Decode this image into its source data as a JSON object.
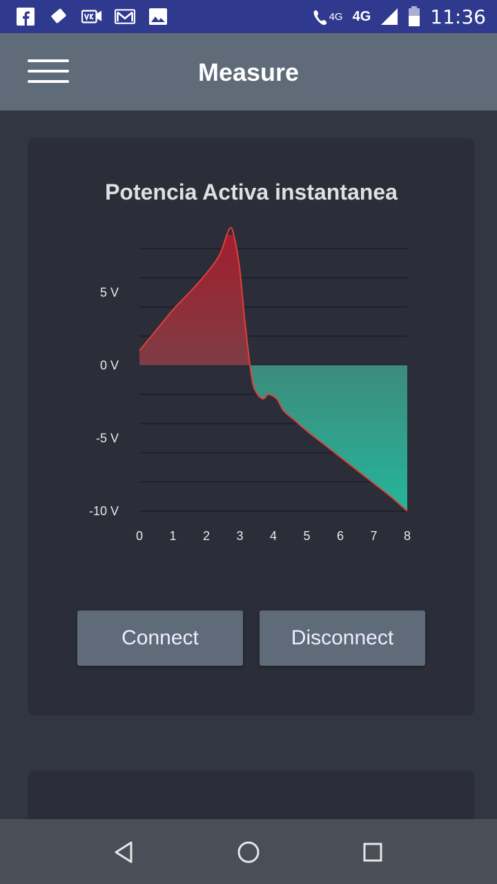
{
  "status_bar": {
    "left_icons": [
      "facebook-icon",
      "tag-icon",
      "vk-icon",
      "gmail-icon",
      "gallery-icon"
    ],
    "volte_label": "4G",
    "network_label": "4G",
    "time": "11:36"
  },
  "app_bar": {
    "title": "Measure"
  },
  "chart_card": {
    "title": "Potencia Activa instantanea",
    "connect_label": "Connect",
    "disconnect_label": "Disconnect"
  },
  "chart_data": {
    "type": "area",
    "title": "Potencia Activa instantanea",
    "x_ticks": [
      "0",
      "1",
      "2",
      "3",
      "4",
      "5",
      "6",
      "7",
      "8"
    ],
    "y_ticks": [
      "5 V",
      "0 V",
      "-5 V",
      "-10 V"
    ],
    "xlim": [
      0,
      8
    ],
    "ylim": [
      -10,
      8
    ],
    "grid": "horizontal",
    "colors": {
      "line": "#e0413b",
      "positive": "#a31d2c",
      "negative": "#25b59b",
      "grid": "#1f2029"
    },
    "series": [
      {
        "x": [
          0,
          0.5,
          1,
          1.5,
          2,
          2.4,
          2.7,
          2.85,
          3.0,
          3.15,
          3.35,
          3.5,
          3.7,
          3.85,
          4.1,
          4.3,
          4.6,
          5,
          5.5,
          6,
          6.5,
          7,
          7.5,
          8
        ],
        "y": [
          1,
          2.4,
          3.8,
          5.0,
          6.3,
          7.6,
          9.4,
          8.6,
          6.5,
          3.0,
          -0.8,
          -1.9,
          -2.3,
          -2.0,
          -2.3,
          -3.1,
          -3.7,
          -4.5,
          -5.4,
          -6.3,
          -7.2,
          -8.1,
          -9.0,
          -10
        ]
      }
    ]
  },
  "nav_bar": {
    "icons": [
      "back-icon",
      "home-icon",
      "recents-icon"
    ]
  }
}
